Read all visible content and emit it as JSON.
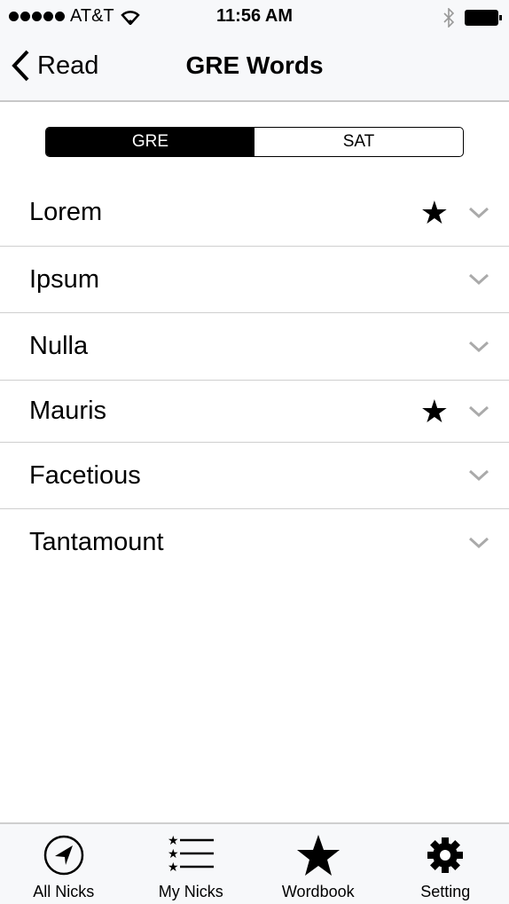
{
  "status": {
    "carrier": "AT&T",
    "time": "11:56 AM"
  },
  "nav": {
    "back_label": "Read",
    "title": "GRE Words"
  },
  "segments": [
    {
      "label": "GRE",
      "selected": true
    },
    {
      "label": "SAT",
      "selected": false
    }
  ],
  "words": [
    {
      "label": "Lorem",
      "starred": true
    },
    {
      "label": "Ipsum",
      "starred": false
    },
    {
      "label": "Nulla",
      "starred": false
    },
    {
      "label": "Mauris",
      "starred": true
    },
    {
      "label": "Facetious",
      "starred": false
    },
    {
      "label": "Tantamount",
      "starred": false
    }
  ],
  "tabs": [
    {
      "label": "All Nicks",
      "icon": "navigation-arrow-icon"
    },
    {
      "label": "My Nicks",
      "icon": "starred-list-icon"
    },
    {
      "label": "Wordbook",
      "icon": "star-icon"
    },
    {
      "label": "Setting",
      "icon": "gear-icon"
    }
  ]
}
